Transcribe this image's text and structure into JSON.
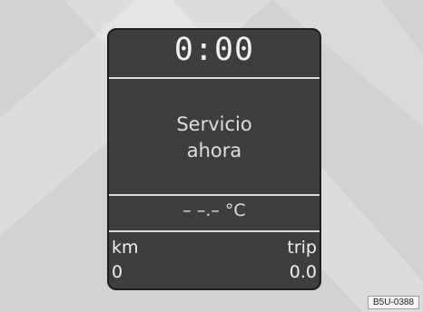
{
  "display": {
    "clock": "0:00",
    "service_line1": "Servicio",
    "service_line2": "ahora",
    "temperature": "– –.– °C",
    "distance_label": "km",
    "distance_value": "0",
    "trip_label": "trip",
    "trip_value": "0.0"
  },
  "figure_code": "B5U-0388",
  "colors": {
    "background": "#d2d2d2",
    "display": "#3e3e3e",
    "text": "#e6e6e6"
  }
}
